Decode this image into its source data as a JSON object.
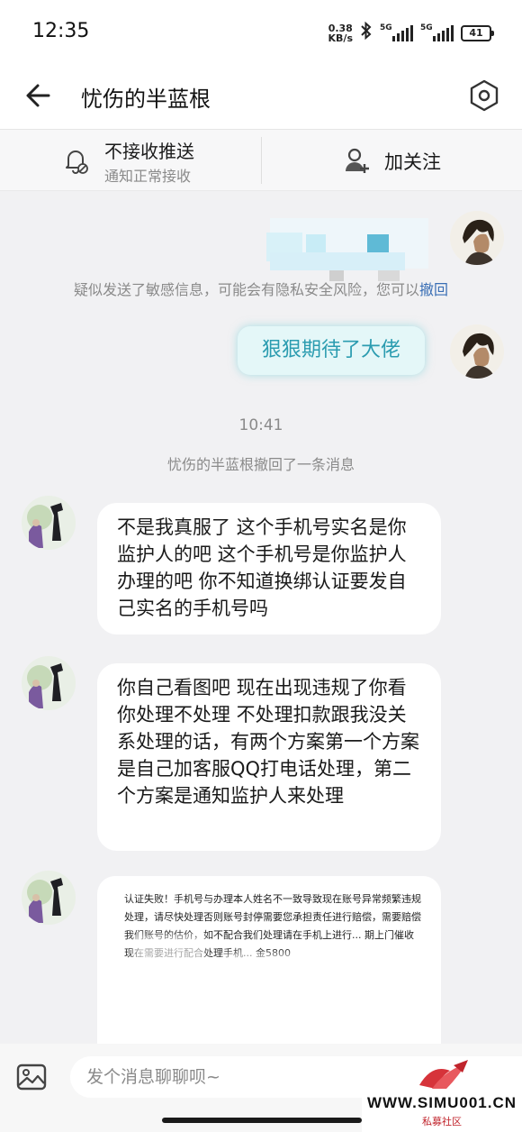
{
  "status_bar": {
    "time": "12:35",
    "net_speed_value": "0.38",
    "net_speed_unit": "KB/s",
    "sim1": "5G",
    "sim2": "5G",
    "battery": "41"
  },
  "header": {
    "title": "忧伤的半蓝根"
  },
  "action_bar": {
    "push_title": "不接收推送",
    "push_subtitle": "通知正常接收",
    "follow_label": "加关注"
  },
  "chat": {
    "sensitive_notice": "疑似发送了敏感信息，可能会有隐私安全风险，您可以",
    "sensitive_link": "撤回",
    "my_message": "狠狠期待了大佬",
    "time_label": "10:41",
    "recall_notice": "忧伤的半蓝根撤回了一条消息",
    "their_messages": [
      "不是我真服了 这个手机号实名是你监护人的吧 这个手机号是你监护人办理的吧 你不知道换绑认证要发自己实名的手机号吗",
      "你自己看图吧 现在出现违规了你看你处理不处理 不处理扣款跟我没关系处理的话，有两个方案第一个方案是自己加客服QQ打电话处理，第二个方案是通知监护人来处理"
    ],
    "image_doc_text": "认证失败！手机号与办理本人姓名不一致导致现在账号异常频繁违规处理，请尽快处理否则账号封停需要您承担责任进行赔偿，需要赔偿我们账号的估价，如不配合我们处理请在手机上进行... 期上门催收现在需要进行配合处理手机... 金5800"
  },
  "input": {
    "placeholder": "发个消息聊聊呗~"
  },
  "watermark": {
    "url": "WWW.SIMU001.CN",
    "subtitle": "私募社区"
  },
  "colors": {
    "accent_teal": "#2b9cb0",
    "link_blue": "#3a6fb5",
    "background": "#f1f1f3"
  },
  "icons": [
    "back-arrow-icon",
    "settings-hex-icon",
    "bell-off-icon",
    "add-user-icon",
    "image-icon",
    "bluetooth-icon"
  ]
}
